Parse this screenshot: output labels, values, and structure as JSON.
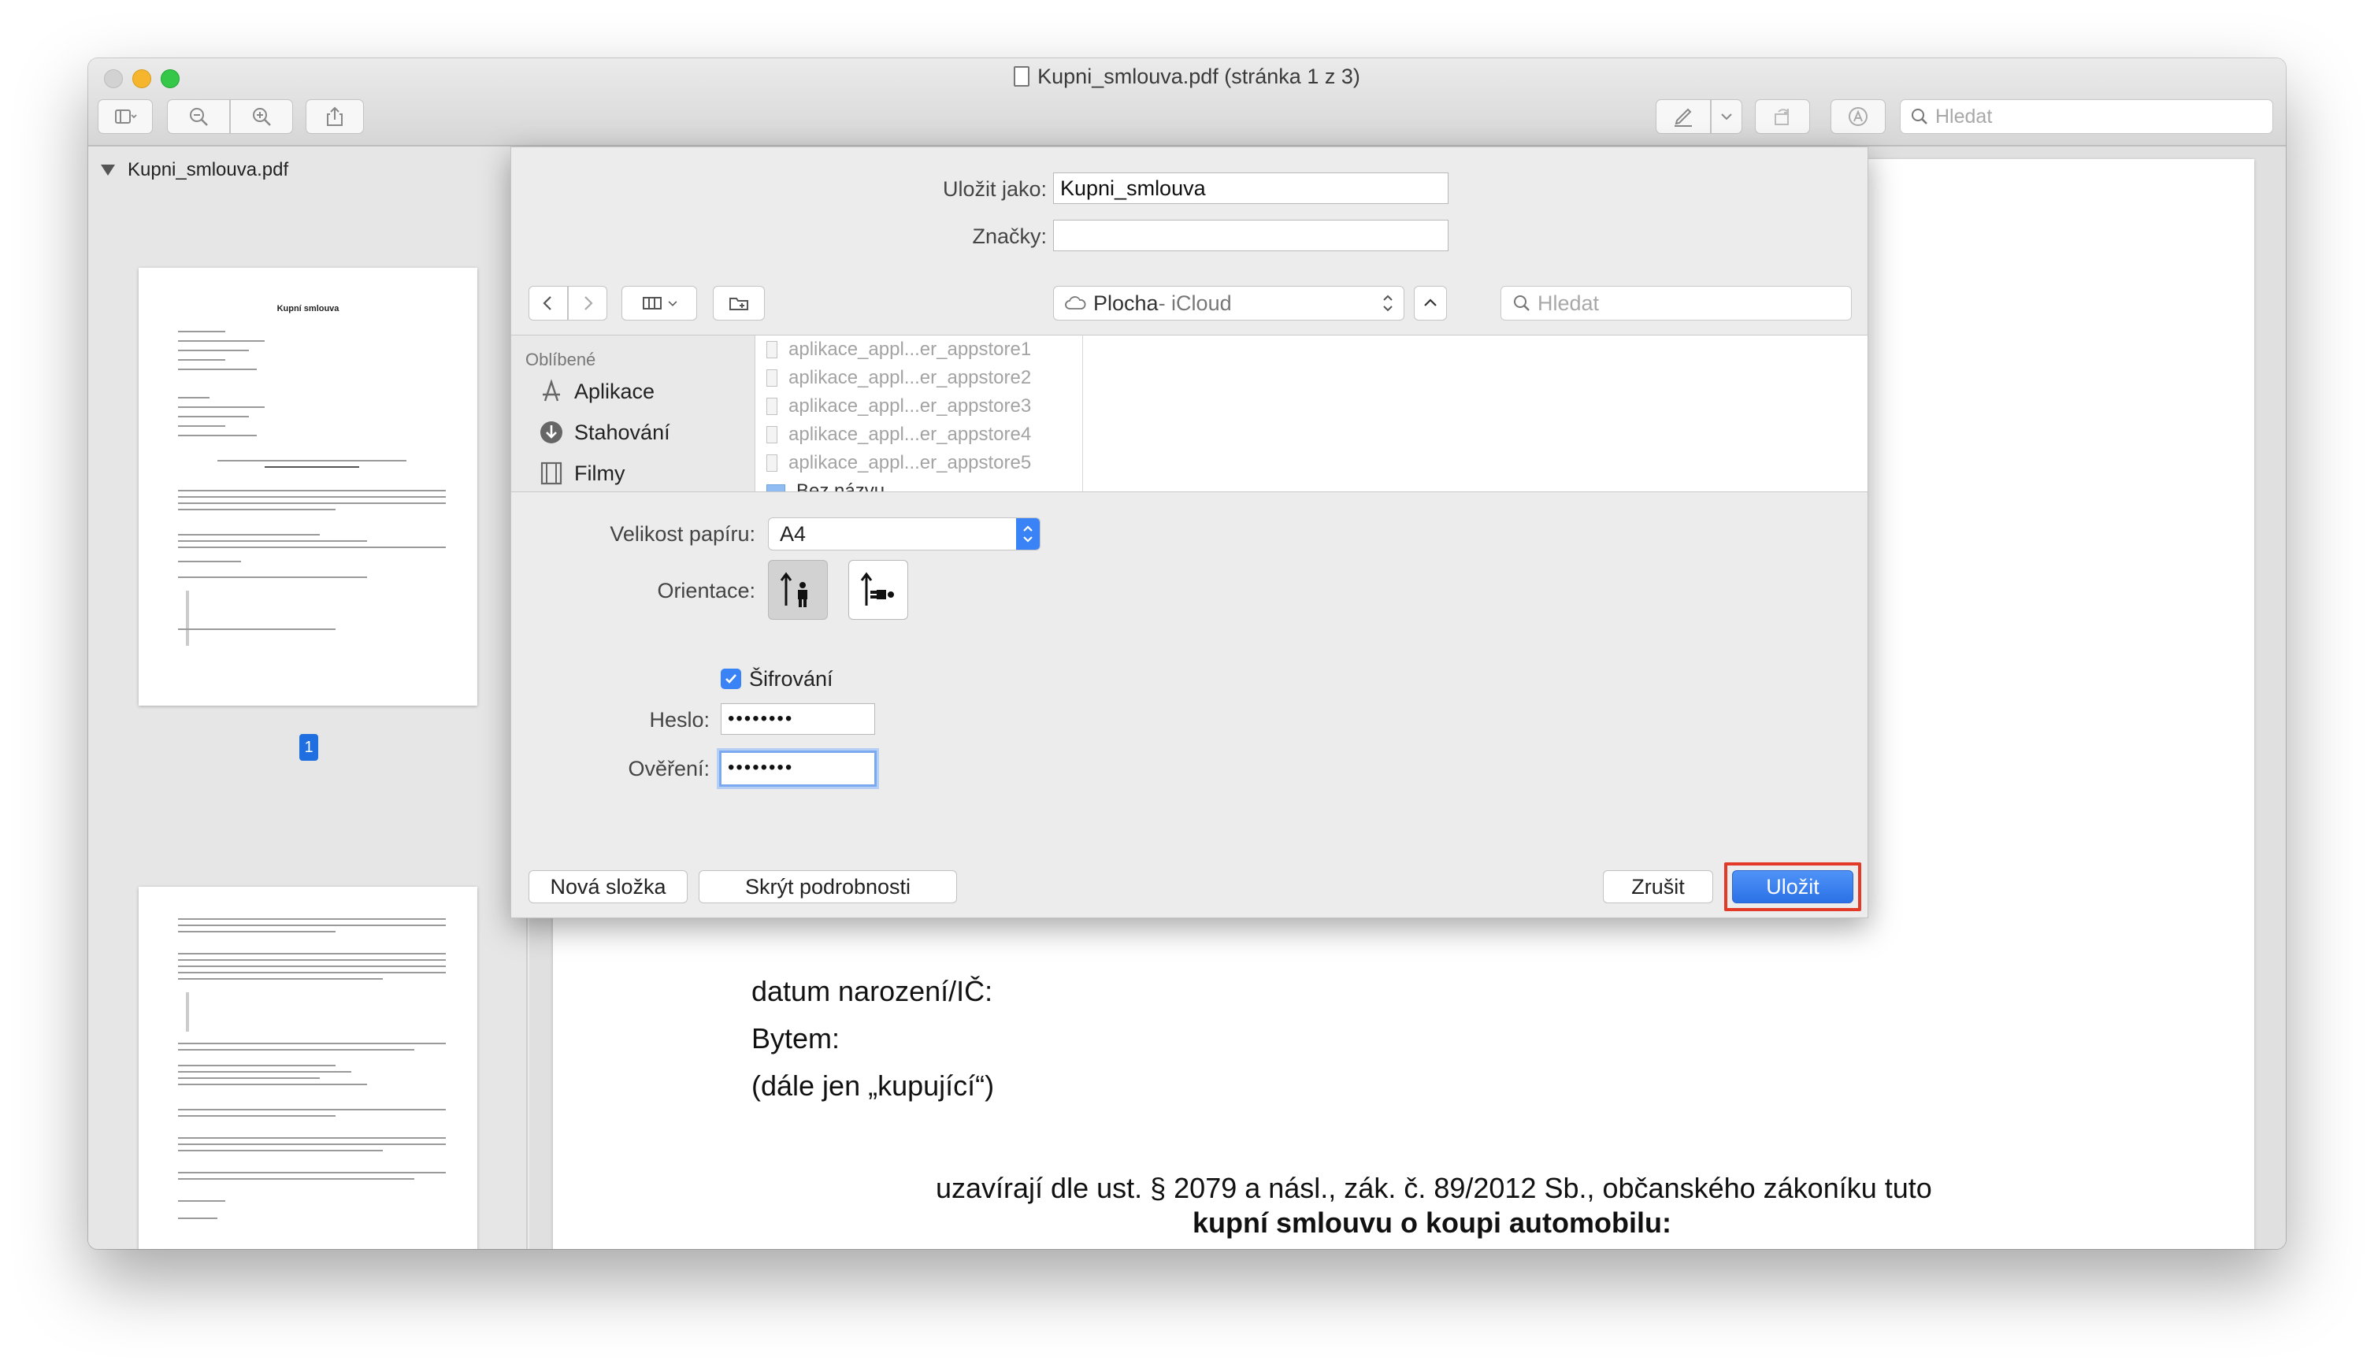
{
  "window": {
    "title": "Kupni_smlouva.pdf (stránka 1 z 3)"
  },
  "toolbar": {
    "search_placeholder": "Hledat"
  },
  "sidebar": {
    "document_name": "Kupni_smlouva.pdf",
    "thumbnail_title": "Kupní smlouva",
    "selected_page": "1"
  },
  "pdf_page": {
    "line_birth": "datum narození/IČ:",
    "line_bytem": "Bytem:",
    "line_dale": "(dále jen „kupující“)",
    "line_uzaviraji": "uzavírají dle ust. § 2079 a násl., zák. č. 89/2012 Sb., občanského zákoníku tuto",
    "line_title": "kupní smlouvu o koupi automobilu:"
  },
  "save_sheet": {
    "save_as_label": "Uložit jako:",
    "save_as_value": "Kupni_smlouva",
    "tags_label": "Značky:",
    "tags_value": "",
    "location_name": "Plocha",
    "location_sub": " - iCloud",
    "search_placeholder": "Hledat",
    "favorites_title": "Oblíbené",
    "favorites": [
      "Aplikace",
      "Stahování",
      "Filmy"
    ],
    "files": [
      "aplikace_appl...er_appstore1",
      "aplikace_appl...er_appstore2",
      "aplikace_appl...er_appstore3",
      "aplikace_appl...er_appstore4",
      "aplikace_appl...er_appstore5",
      "Bez názvu"
    ],
    "paper_size_label": "Velikost papíru:",
    "paper_size_value": "A4",
    "orientation_label": "Orientace:",
    "encryption_label": "Šifrování",
    "encryption_checked": true,
    "password_label": "Heslo:",
    "password_value": "••••••••",
    "verify_label": "Ověření:",
    "verify_value": "••••••••",
    "new_folder_button": "Nová složka",
    "hide_details_button": "Skrýt podrobnosti",
    "cancel_button": "Zrušit",
    "save_button": "Uložit"
  },
  "colors": {
    "accent": "#3a83f6",
    "highlight": "#e23a26"
  }
}
